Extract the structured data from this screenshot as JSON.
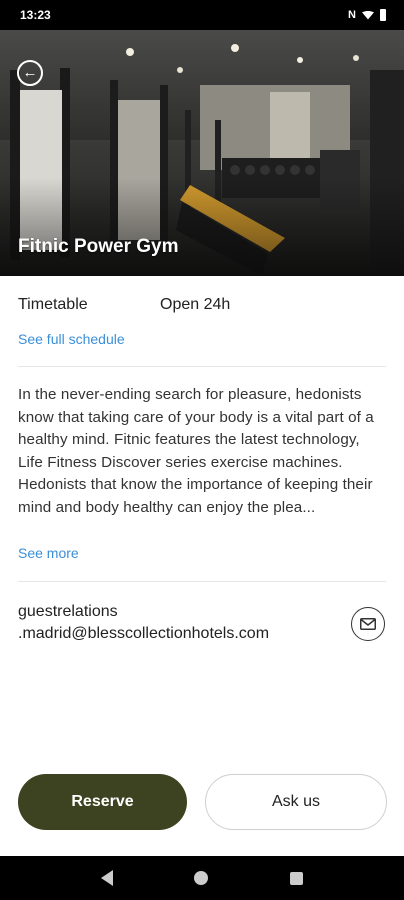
{
  "status_bar": {
    "time": "13:23"
  },
  "hero": {
    "title": "Fitnic Power Gym"
  },
  "timetable": {
    "label": "Timetable",
    "value": "Open 24h",
    "link": "See full schedule"
  },
  "description": {
    "text": "In the never-ending search for pleasure, hedonists know that taking care of your body is a vital part of a healthy mind. Fitnic features the latest technology, Life Fitness Discover series exercise machines. Hedonists that know the importance of keeping their mind and body healthy can enjoy the plea...",
    "see_more": "See more"
  },
  "contact": {
    "email_line1": "guestrelations",
    "email_line2": ".madrid@blesscollectionhotels.com"
  },
  "actions": {
    "reserve": "Reserve",
    "ask": "Ask us"
  }
}
